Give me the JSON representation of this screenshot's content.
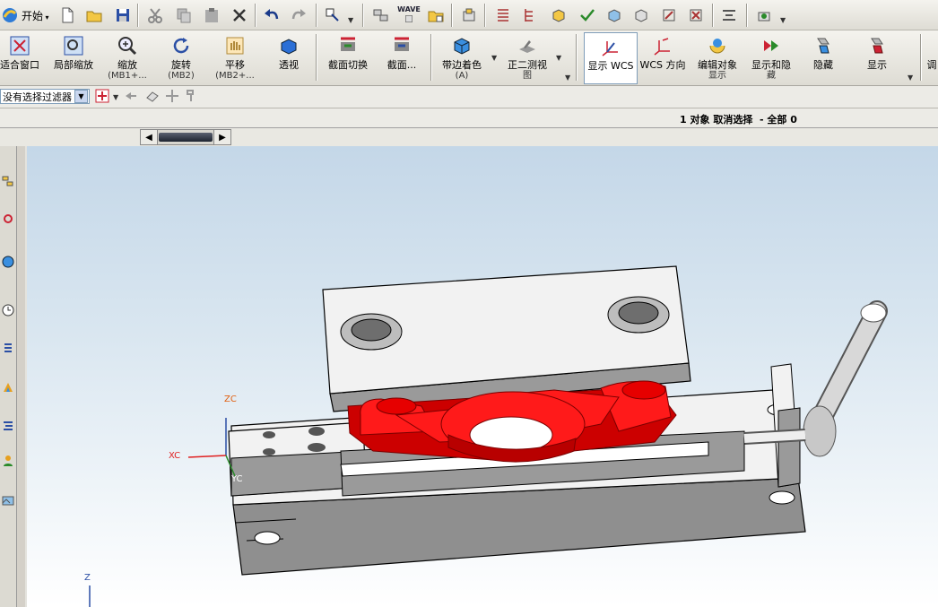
{
  "toolbar_top": {
    "start_label": "开始",
    "icons": [
      "new-file-icon",
      "open-folder-icon",
      "save-icon",
      "cut-icon",
      "copy-icon",
      "paste-icon",
      "delete-icon",
      "undo-icon",
      "redo-icon",
      "selection-icon",
      "assembly-icon",
      "wave-icon",
      "wave-link-icon",
      "component-icon",
      "list-icon",
      "tree-icon",
      "cube-icon",
      "check-icon",
      "cube-arrange-icon",
      "cube-explode-icon",
      "display-edit-icon",
      "color-icon",
      "layer-icon",
      "camera-icon"
    ],
    "wave_label": "WAVE"
  },
  "toolbar_view": {
    "buttons": [
      {
        "label": "适合窗口",
        "sub": ""
      },
      {
        "label": "局部缩放",
        "sub": ""
      },
      {
        "label": "缩放",
        "sub": "(MB1+..."
      },
      {
        "label": "旋转",
        "sub": "(MB2)"
      },
      {
        "label": "平移",
        "sub": "(MB2+..."
      },
      {
        "label": "透视",
        "sub": ""
      },
      {
        "label": "截面切换",
        "sub": ""
      },
      {
        "label": "截面...",
        "sub": ""
      },
      {
        "label": "带边着色",
        "sub": "(A)"
      },
      {
        "label": "正二测视",
        "sub": "图"
      },
      {
        "label": "显示 WCS",
        "sub": ""
      },
      {
        "label": "WCS 方向",
        "sub": ""
      },
      {
        "label": "编辑对象",
        "sub": "显示"
      },
      {
        "label": "显示和隐",
        "sub": "藏"
      },
      {
        "label": "隐藏",
        "sub": ""
      },
      {
        "label": "显示",
        "sub": ""
      },
      {
        "label": "调",
        "sub": ""
      }
    ]
  },
  "selection_bar": {
    "filter_value": "没有选择过滤器"
  },
  "status": {
    "text": "1 对象 取消选择  - 全部 0"
  },
  "viewport": {
    "axis_labels": {
      "zc": "ZC",
      "xc": "XC",
      "yc": "YC",
      "z": "Z"
    },
    "colors": {
      "part_highlight": "#ff1a1a",
      "body": "#f2f2f2",
      "shadow": "#8f8f8f",
      "bg_top": "#c4d7e8",
      "bg_bottom": "#ffffff"
    }
  }
}
